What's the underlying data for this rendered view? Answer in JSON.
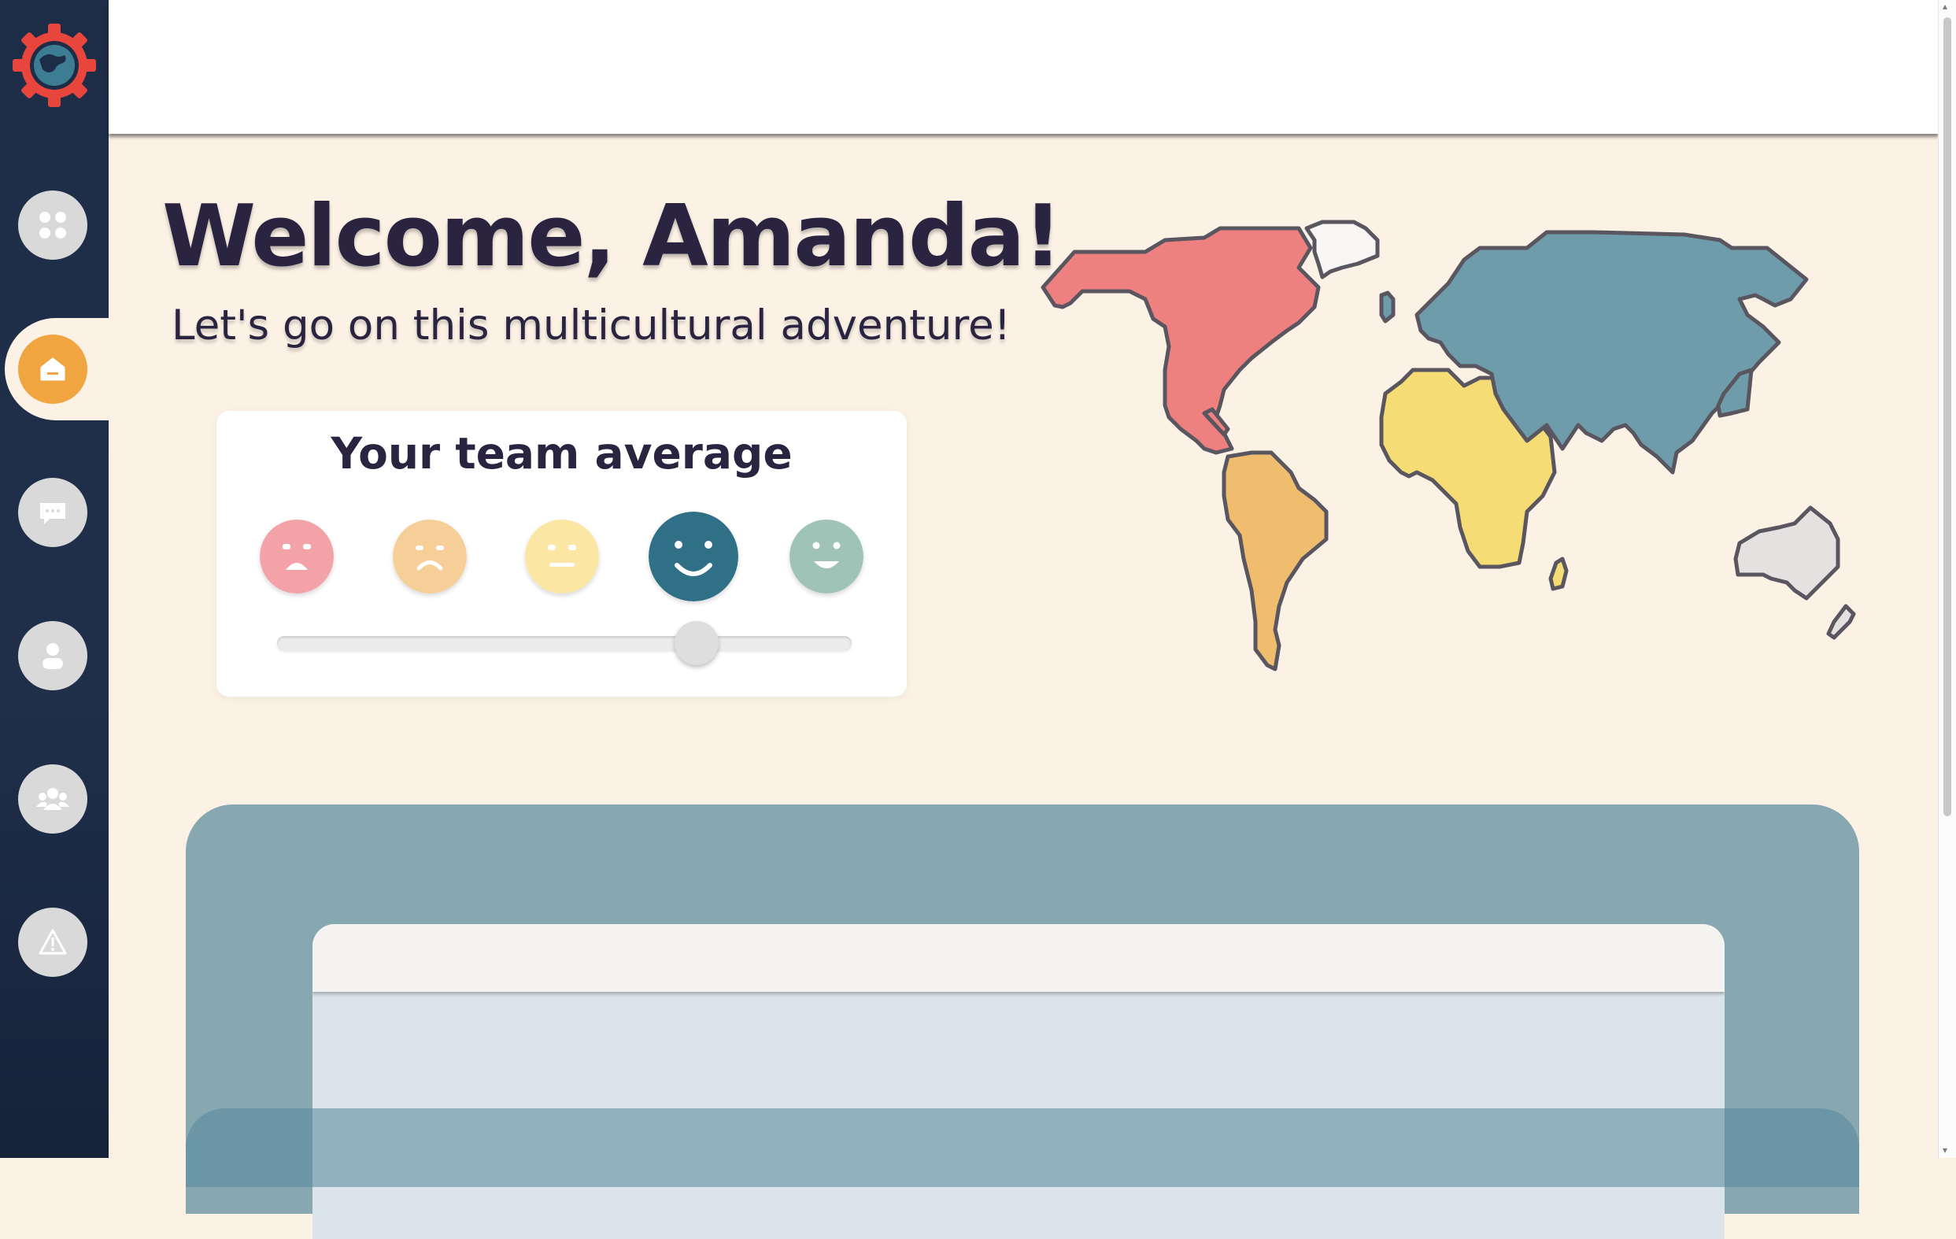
{
  "header": {
    "welcome": "Welcome, Amanda!",
    "subtitle": "Let's go on this multicultural adventure!"
  },
  "sidebar": {
    "items": [
      {
        "name": "dashboard",
        "icon": "grid-icon",
        "active": false
      },
      {
        "name": "home",
        "icon": "home-icon",
        "active": true
      },
      {
        "name": "chat",
        "icon": "chat-icon",
        "active": false
      },
      {
        "name": "profile",
        "icon": "user-icon",
        "active": false
      },
      {
        "name": "team",
        "icon": "group-icon",
        "active": false
      },
      {
        "name": "alerts",
        "icon": "warning-icon",
        "active": false
      }
    ]
  },
  "team_average": {
    "title": "Your team average",
    "moods": [
      "very-sad",
      "sad",
      "neutral",
      "happy",
      "very-happy"
    ],
    "selected_mood": "happy",
    "slider_fraction": 0.73
  },
  "colors": {
    "sidebar": "#1e2d47",
    "background": "#fbf1e5",
    "accent": "#f0a540",
    "text": "#2a2440",
    "north_america": "#ef8080",
    "south_america": "#f0bd6f",
    "africa": "#f5dc74",
    "asia_europe": "#6e9cab",
    "oceania": "#e6e1e1",
    "selected_face": "#2f7087"
  }
}
